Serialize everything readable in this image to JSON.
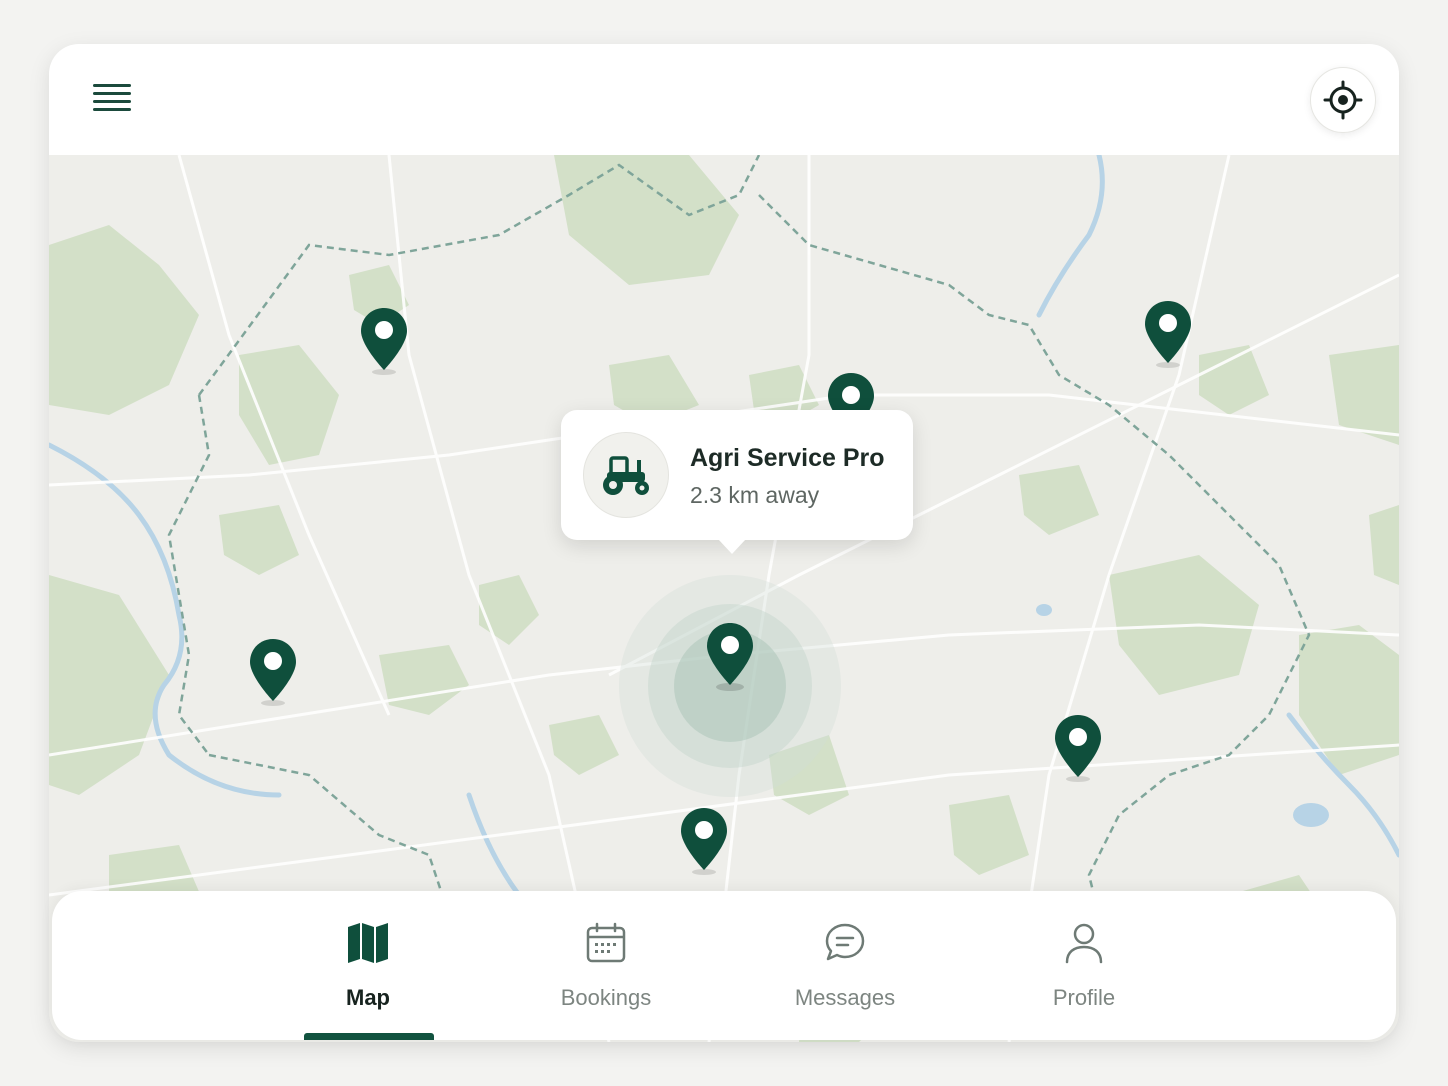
{
  "colors": {
    "accent": "#0f4f3c",
    "map_land": "#eeeeea",
    "map_green": "#d2e0c6",
    "map_water": "#b6d5ea"
  },
  "header": {
    "menu_icon": "hamburger-menu-icon",
    "locate_icon": "crosshair-locate-icon"
  },
  "callout": {
    "title": "Agri Service Pro",
    "distance": "2.3 km away",
    "icon": "tractor-icon"
  },
  "tabs": [
    {
      "label": "Map",
      "icon": "map-icon",
      "active": true
    },
    {
      "label": "Bookings",
      "icon": "calendar-icon",
      "active": false
    },
    {
      "label": "Messages",
      "icon": "chat-bubble-icon",
      "active": false
    },
    {
      "label": "Profile",
      "icon": "person-icon",
      "active": false
    }
  ]
}
